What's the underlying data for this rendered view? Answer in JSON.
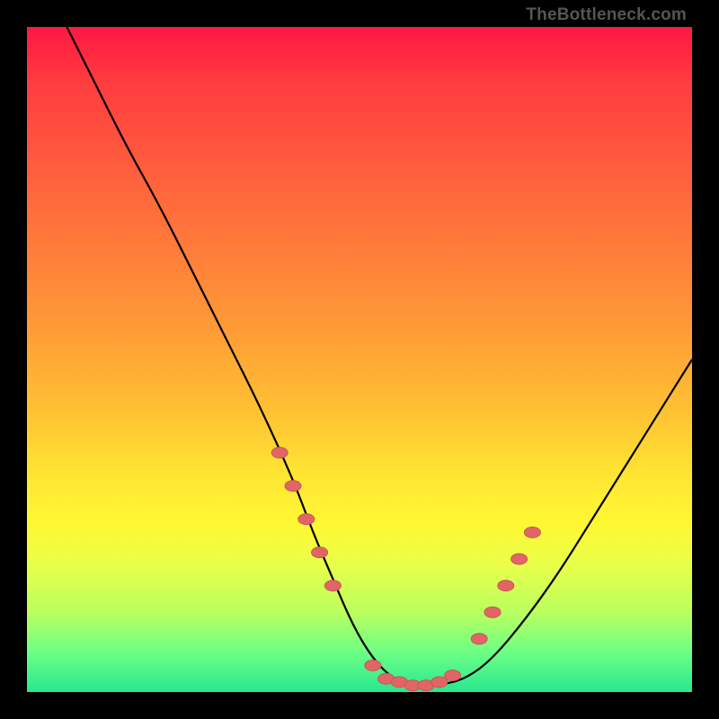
{
  "attribution": "TheBottleneck.com",
  "colors": {
    "frame": "#000000",
    "gradient_top": "#ff1744",
    "gradient_mid": "#ffe733",
    "gradient_bottom": "#28e78f",
    "curve": "#000000",
    "marker": "#e06666",
    "marker_stroke": "#cc5555"
  },
  "chart_data": {
    "type": "line",
    "title": "",
    "xlabel": "",
    "ylabel": "",
    "xlim": [
      0,
      100
    ],
    "ylim": [
      0,
      100
    ],
    "series": [
      {
        "name": "bottleneck-curve",
        "x": [
          6,
          10,
          15,
          20,
          25,
          30,
          35,
          40,
          43,
          46,
          49,
          52,
          55,
          58,
          62,
          66,
          70,
          75,
          80,
          85,
          90,
          95,
          100
        ],
        "y": [
          100,
          92,
          82,
          73,
          63,
          53,
          43,
          32,
          24,
          17,
          10,
          5,
          2,
          1,
          1,
          2,
          5,
          11,
          18,
          26,
          34,
          42,
          50
        ]
      }
    ],
    "markers": {
      "name": "highlight-points",
      "left_cluster": {
        "x": [
          38,
          40,
          42,
          44,
          46
        ],
        "y": [
          36,
          31,
          26,
          21,
          16
        ]
      },
      "bottom_cluster": {
        "x": [
          52,
          54,
          56,
          58,
          60,
          62,
          64
        ],
        "y": [
          4,
          2,
          1.5,
          1,
          1,
          1.5,
          2.5
        ]
      },
      "right_cluster": {
        "x": [
          68,
          70,
          72,
          74,
          76
        ],
        "y": [
          8,
          12,
          16,
          20,
          24
        ]
      }
    }
  }
}
